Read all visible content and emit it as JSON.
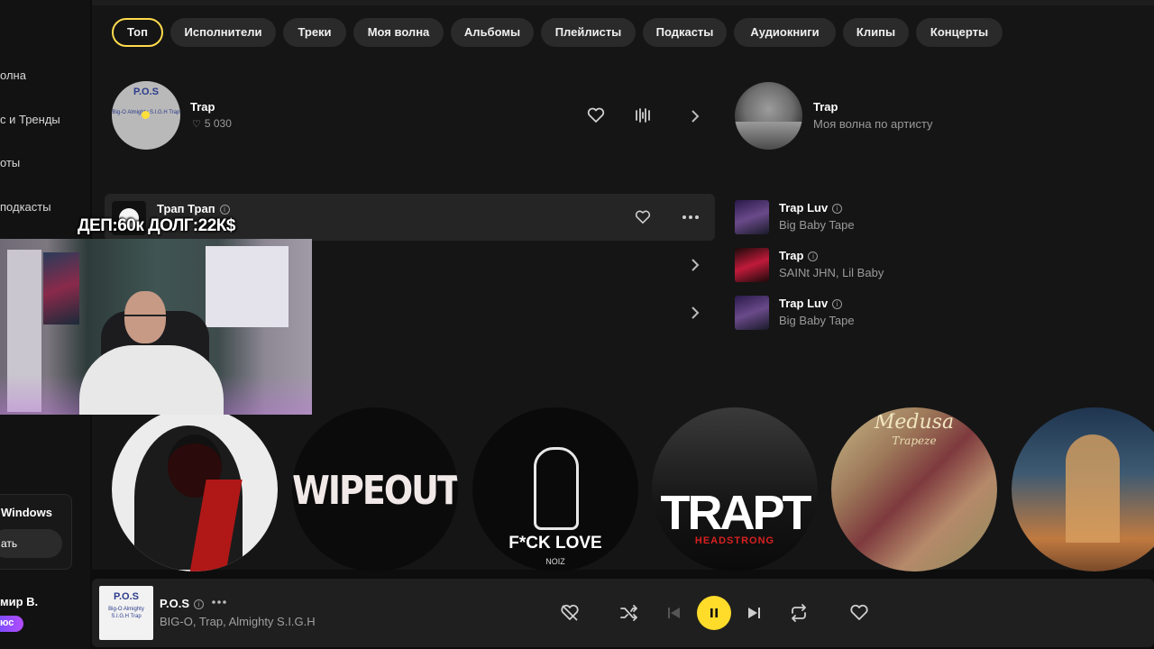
{
  "sidebar": {
    "items": [
      "олна",
      "с и Тренды",
      "оты",
      "подкасты"
    ],
    "promo_title": "Windows",
    "promo_button": "ать",
    "user_name": "мир В.",
    "badge": "юс"
  },
  "filters": [
    {
      "label": "Топ",
      "active": true
    },
    {
      "label": "Исполнители",
      "active": false
    },
    {
      "label": "Треки",
      "active": false
    },
    {
      "label": "Моя волна",
      "active": false
    },
    {
      "label": "Альбомы",
      "active": false
    },
    {
      "label": "Плейлисты",
      "active": false
    },
    {
      "label": "Подкасты",
      "active": false
    },
    {
      "label": "Аудиокниги",
      "active": false
    },
    {
      "label": "Клипы",
      "active": false
    },
    {
      "label": "Концерты",
      "active": false
    }
  ],
  "top_artist": {
    "cover_title": "P.O.S",
    "cover_sub": "Big-O Almighty S.I.G.H Trap",
    "name": "Trap",
    "likes": "5 030"
  },
  "wave": {
    "title": "Trap",
    "subtitle": "Моя волна по артисту"
  },
  "main_track": {
    "title": "Трап Трап"
  },
  "overlay": "ДЕП:60к ДОЛГ:22К$",
  "right_tracks": [
    {
      "title": "Trap Luv",
      "artist": "Big Baby Tape",
      "cover": "#3a2a4a"
    },
    {
      "title": "Trap",
      "artist": "SAINt JHN, Lil Baby",
      "cover": "#4a1a1a"
    },
    {
      "title": "Trap Luv",
      "artist": "Big Baby Tape",
      "cover": "#3a2a4a"
    }
  ],
  "circle_cards": {
    "c2": "WIPEOUT",
    "c3_title": "F*CK LOVE",
    "c3_sub": "NOIZ",
    "c4_title": "TRAPT",
    "c4_sub": "HEADSTRONG",
    "c5_title": "Medusa",
    "c5_sub": "Trapeze"
  },
  "player": {
    "cover_title": "P.O.S",
    "cover_sub": "Big-O Almighty S.I.G.H Trap",
    "title": "P.O.S",
    "artists": "BIG-O, Trap, Almighty S.I.G.H"
  },
  "colors": {
    "accent": "#ffdb2a",
    "background": "#151515",
    "chip": "#2a2a2a"
  }
}
